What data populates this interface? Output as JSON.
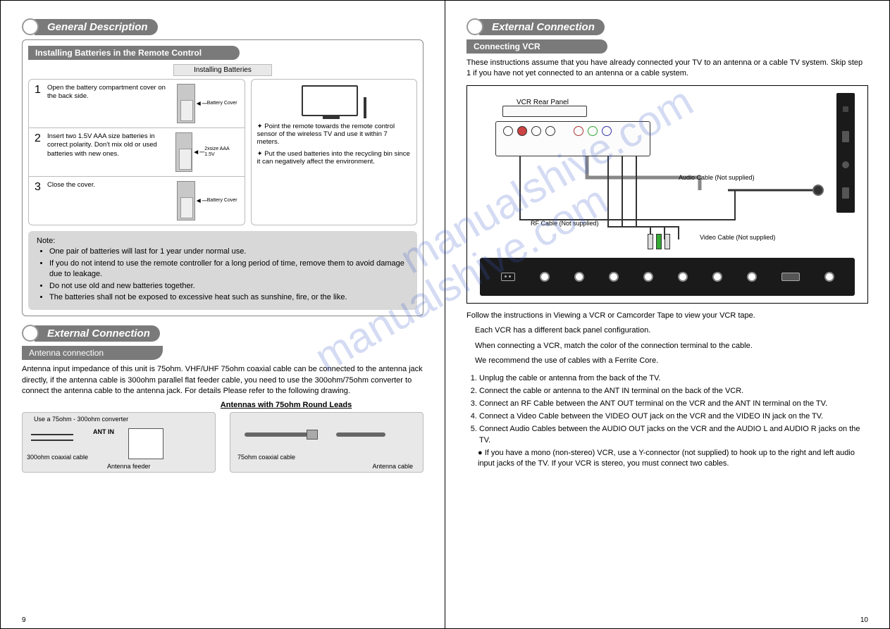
{
  "left": {
    "section1_title": "General Description",
    "sub1_title": "Installing Batteries in the Remote Control",
    "inner_label": "Installing Batteries",
    "steps": [
      {
        "num": "1",
        "text": "Open the battery compartment cover on the back side.",
        "cap": "Battery Cover"
      },
      {
        "num": "2",
        "text": "Insert two 1.5V AAA size batteries in correct polarity. Don't mix old or used batteries with new ones.",
        "cap": "2xsize AAA 1.5V"
      },
      {
        "num": "3",
        "text": "Close the cover.",
        "cap": "Battery Cover"
      }
    ],
    "tip1": "Point the remote towards the remote control sensor of the wireless TV and use it within 7 meters.",
    "tip2": "Put the used batteries into the recycling bin since it can negatively affect the environment.",
    "note_title": "Note:",
    "notes": [
      "One pair of batteries will last for 1 year under normal use.",
      "If you do not intend to use the remote controller for a long period of time, remove them to avoid damage due to leakage.",
      "Do not use old and new batteries together.",
      "The batteries shall not be exposed to excessive heat such as sunshine, fire, or the like."
    ],
    "section2_title": "External Connection",
    "antenna_title": "Antenna connection",
    "antenna_para": "Antenna input impedance of this unit is 75ohm. VHF/UHF 75ohm coaxial cable can be connected to the antenna jack directly, if the antenna cable is 300ohm parallel flat feeder cable, you need to use the 300ohm/75ohm converter to connect the antenna cable to the antenna jack. For details Please refer to the following drawing.",
    "antenna_heading": "Antennas with 75ohm Round Leads",
    "img1": {
      "l1": "Use a 75ohm - 300ohm converter",
      "l2": "ANT IN",
      "l3": "300ohm coaxial cable",
      "l4": "Antenna feeder"
    },
    "img2": {
      "l1": "75ohm coaxial cable",
      "l2": "Antenna cable"
    },
    "page_num": "9"
  },
  "right": {
    "section_title": "External Connection",
    "sub_title": "Connecting VCR",
    "intro": "These instructions assume that you have already connected your TV to an antenna or a cable TV system. Skip step 1 if you have not yet connected to an antenna or a cable system.",
    "diagram": {
      "vcr_label": "VCR Rear Panel",
      "audio_cable": "Audio Cable (Not supplied)",
      "rf_cable": "RF Cable (Not supplied)",
      "video_cable": "Video Cable (Not supplied)"
    },
    "follow": "Follow the instructions in Viewing a VCR or Camcorder Tape to view your VCR tape.",
    "follow_sub1": "Each VCR has a different back panel configuration.",
    "follow_sub2": "When connecting a VCR, match the color of the connection terminal to the cable.",
    "follow_sub3": "We recommend the use of cables with a Ferrite Core.",
    "steps": [
      "Unplug the cable or antenna from the back of the TV.",
      "Connect the cable or antenna to the ANT IN terminal on the back of the VCR.",
      "Connect an RF Cable between the ANT OUT terminal on the VCR and the ANT IN terminal on the TV.",
      "Connect a Video Cable between the VIDEO OUT jack on the VCR and the VIDEO IN jack on the TV.",
      "Connect Audio Cables between the AUDIO OUT jacks on the VCR and the AUDIO L and AUDIO R jacks on the TV."
    ],
    "bullet": "If you have a mono (non-stereo) VCR, use a Y-connector (not supplied) to hook up to the right and left audio input jacks of the TV. If your VCR is stereo, you must connect two cables.",
    "page_num": "10"
  },
  "watermark": "manualshive.com"
}
